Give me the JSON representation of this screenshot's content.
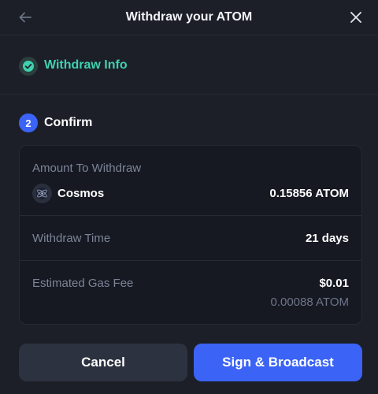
{
  "header": {
    "title": "Withdraw your ATOM",
    "back_icon": "arrow-left-icon",
    "close_icon": "close-icon"
  },
  "steps": {
    "step1": {
      "label": "Withdraw Info",
      "status": "completed",
      "icon": "check-circle-icon"
    },
    "step2": {
      "number": "2",
      "label": "Confirm",
      "status": "active"
    }
  },
  "details": {
    "amount_label": "Amount To Withdraw",
    "coin_name": "Cosmos",
    "coin_icon": "cosmos-icon",
    "amount_value": "0.15856 ATOM",
    "time_label": "Withdraw Time",
    "time_value": "21 days",
    "gas_label": "Estimated Gas Fee",
    "gas_usd": "$0.01",
    "gas_atom": "0.00088 ATOM"
  },
  "actions": {
    "cancel_label": "Cancel",
    "sign_label": "Sign & Broadcast"
  },
  "colors": {
    "background": "#1c1f28",
    "card": "#161922",
    "accent": "#3b63f5",
    "success": "#3fd1b0",
    "muted": "#7c8598"
  }
}
